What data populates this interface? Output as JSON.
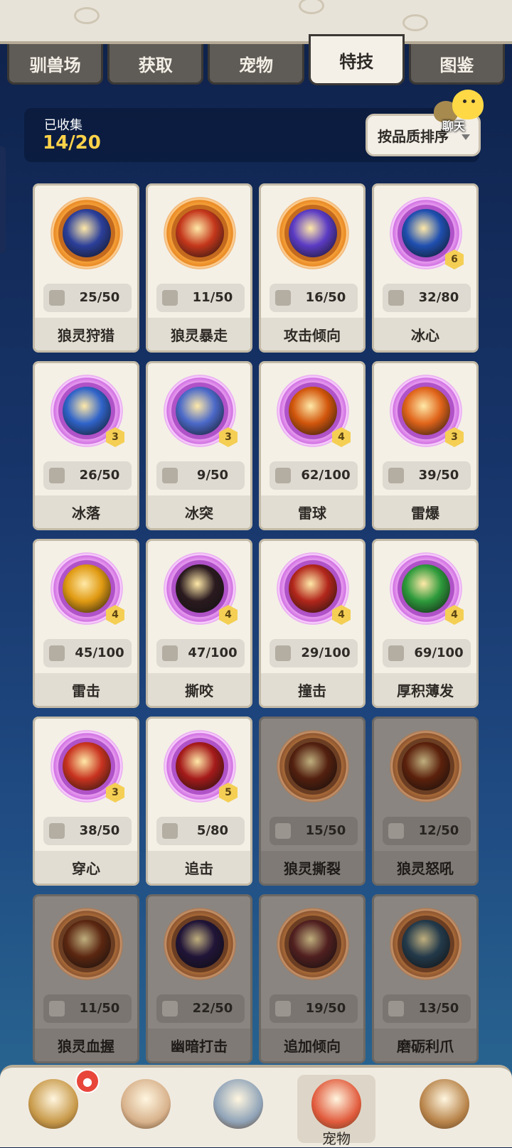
{
  "tabs": [
    "驯兽场",
    "获取",
    "宠物",
    "特技",
    "图鉴"
  ],
  "active_tab": "特技",
  "collection": {
    "label": "已收集",
    "value": "14/20"
  },
  "sort_button": {
    "label": "按品质排序"
  },
  "chat_button": {
    "label": "聊天"
  },
  "skills": [
    {
      "name": "狼灵狩猎",
      "progress": "25/50",
      "stars": "",
      "ring": "orange",
      "inner": "#2b3f9a",
      "locked": false
    },
    {
      "name": "狼灵暴走",
      "progress": "11/50",
      "stars": "",
      "ring": "orange",
      "inner": "#c4371b",
      "locked": false
    },
    {
      "name": "攻击倾向",
      "progress": "16/50",
      "stars": "",
      "ring": "orange",
      "inner": "#5b3bc4",
      "locked": false
    },
    {
      "name": "冰心",
      "progress": "32/80",
      "stars": "6",
      "ring": "pink",
      "inner": "#1f4fb0",
      "locked": false
    },
    {
      "name": "冰落",
      "progress": "26/50",
      "stars": "3",
      "ring": "pink",
      "inner": "#2f63c9",
      "locked": false
    },
    {
      "name": "冰突",
      "progress": "9/50",
      "stars": "3",
      "ring": "pink",
      "inner": "#4b69c9",
      "locked": false
    },
    {
      "name": "雷球",
      "progress": "62/100",
      "stars": "4",
      "ring": "pink",
      "inner": "#d2560c",
      "locked": false
    },
    {
      "name": "雷爆",
      "progress": "39/50",
      "stars": "3",
      "ring": "pink",
      "inner": "#e0641a",
      "locked": false
    },
    {
      "name": "雷击",
      "progress": "45/100",
      "stars": "4",
      "ring": "pink",
      "inner": "#e09a12",
      "locked": false
    },
    {
      "name": "撕咬",
      "progress": "47/100",
      "stars": "4",
      "ring": "pink",
      "inner": "#2a1a1f",
      "locked": false
    },
    {
      "name": "撞击",
      "progress": "29/100",
      "stars": "4",
      "ring": "pink",
      "inner": "#b2261b",
      "locked": false
    },
    {
      "name": "厚积薄发",
      "progress": "69/100",
      "stars": "4",
      "ring": "pink",
      "inner": "#2d9a3b",
      "locked": false
    },
    {
      "name": "穿心",
      "progress": "38/50",
      "stars": "3",
      "ring": "pink",
      "inner": "#c8331f",
      "locked": false
    },
    {
      "name": "追击",
      "progress": "5/80",
      "stars": "5",
      "ring": "pink",
      "inner": "#a51a1a",
      "locked": false
    },
    {
      "name": "狼灵撕裂",
      "progress": "15/50",
      "stars": "",
      "ring": "dim",
      "inner": "#6e2a14",
      "locked": true
    },
    {
      "name": "狼灵怒吼",
      "progress": "12/50",
      "stars": "",
      "ring": "dim",
      "inner": "#7a2c10",
      "locked": true
    },
    {
      "name": "狼灵血握",
      "progress": "11/50",
      "stars": "",
      "ring": "dim",
      "inner": "#7a3417",
      "locked": true
    },
    {
      "name": "幽暗打击",
      "progress": "22/50",
      "stars": "",
      "ring": "dim",
      "inner": "#2b1b4a",
      "locked": true
    },
    {
      "name": "追加倾向",
      "progress": "19/50",
      "stars": "",
      "ring": "dim",
      "inner": "#6b2a2a",
      "locked": true
    },
    {
      "name": "磨砺利爪",
      "progress": "13/50",
      "stars": "",
      "ring": "dim",
      "inner": "#2f4d63",
      "locked": true
    }
  ],
  "bottom_nav": [
    {
      "icon": "caveman-avatar-icon",
      "label": "",
      "color": "#c89a4a"
    },
    {
      "icon": "hunter-avatar-icon",
      "label": "",
      "color": "#d8b28c"
    },
    {
      "icon": "sword-icon",
      "label": "",
      "color": "#8fa3b8"
    },
    {
      "icon": "pet-dragon-icon",
      "label": "宠物",
      "color": "#e15a3c"
    },
    {
      "icon": "totem-icon",
      "label": "",
      "color": "#b8844a"
    }
  ],
  "notification": {
    "icon": "bell-icon"
  }
}
